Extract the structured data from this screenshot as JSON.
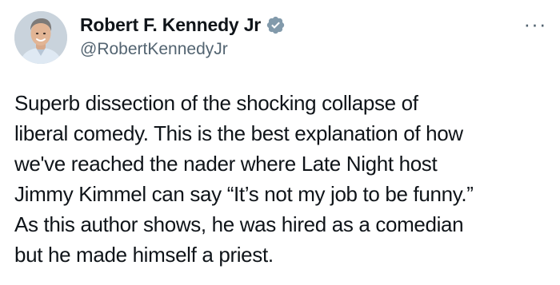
{
  "author": {
    "display_name": "Robert F. Kennedy Jr",
    "handle": "@RobertKennedyJr",
    "verified": true,
    "verified_color": "#829aab"
  },
  "menu": {
    "more_label": "···"
  },
  "tweet": {
    "lines": [
      "Superb dissection of the shocking collapse of",
      "liberal comedy. This is the best explanation of how",
      "we've reached the nader where Late Night host",
      "Jimmy Kimmel can say “It’s not my job to be funny.”",
      "As this author shows, he was hired as a comedian",
      "but he made himself a priest."
    ]
  },
  "colors": {
    "text": "#0f1419",
    "secondary": "#536471",
    "background": "#ffffff"
  }
}
